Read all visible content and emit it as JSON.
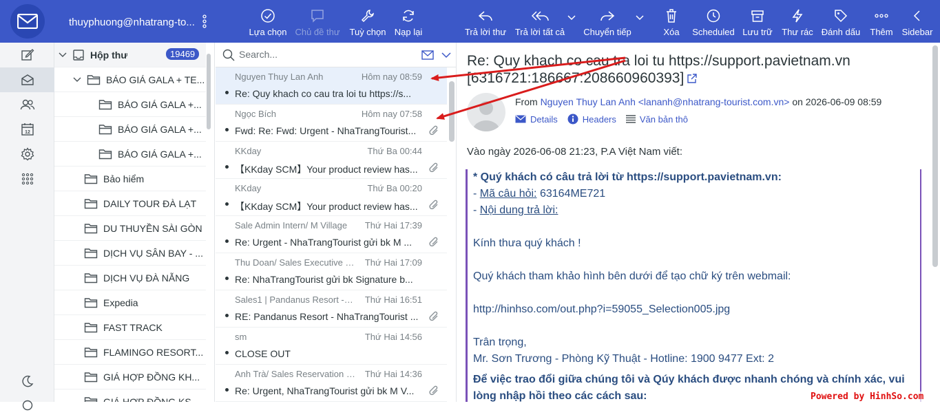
{
  "account": "thuyphuong@nhatrang-to...",
  "toolbar": {
    "select": "Lựa chọn",
    "thread": "Chủ đề thư",
    "options": "Tuỳ chọn",
    "refresh": "Nạp lại",
    "reply": "Trả lời thư",
    "reply_all": "Trả lời tất cả",
    "forward": "Chuyển tiếp",
    "delete": "Xóa",
    "scheduled": "Scheduled",
    "archive": "Lưu trữ",
    "junk": "Thư rác",
    "mark": "Đánh dấu",
    "more": "Thêm",
    "sidebar": "Sidebar"
  },
  "folders": {
    "inbox": {
      "label": "Hộp thư",
      "count": "19469"
    },
    "items": [
      {
        "label": "BÁO GIÁ GALA + TE...",
        "icon": "folder-icon"
      },
      {
        "label": "BÁO GIÁ GALA +...",
        "icon": "folder-icon"
      },
      {
        "label": "BÁO GIÁ GALA +...",
        "icon": "folder-icon"
      },
      {
        "label": "BÁO GIÁ GALA +...",
        "icon": "folder-icon"
      },
      {
        "label": "Bảo hiểm",
        "icon": "folder-icon"
      },
      {
        "label": "DAILY TOUR ĐÀ LẠT",
        "icon": "folder-icon"
      },
      {
        "label": "DU THUYỀN SÀI GÒN",
        "icon": "folder-icon"
      },
      {
        "label": "DỊCH VỤ SÂN BAY - ...",
        "icon": "folder-icon"
      },
      {
        "label": "DỊCH VỤ ĐÀ NẴNG",
        "icon": "folder-icon"
      },
      {
        "label": "Expedia",
        "icon": "folder-icon"
      },
      {
        "label": "FAST TRACK",
        "icon": "folder-icon"
      },
      {
        "label": "FLAMINGO RESORT...",
        "icon": "folder-icon"
      },
      {
        "label": "GIÁ HỢP ĐỒNG KH...",
        "icon": "folder-icon"
      },
      {
        "label": "GIÁ HỢP ĐỒNG KS...",
        "icon": "folder-icon"
      }
    ]
  },
  "search": {
    "placeholder": "Search..."
  },
  "messages": [
    {
      "from": "Nguyen Thuy Lan Anh",
      "date": "Hôm nay 08:59",
      "subject": "Re: Quy khach co cau tra loi tu https://s...",
      "attachment": false
    },
    {
      "from": "Ngọc Bích",
      "date": "Hôm nay 07:58",
      "subject": "Fwd: Re: Fwd: Urgent - NhaTrangTourist...",
      "attachment": true
    },
    {
      "from": "KKday",
      "date": "Thứ Ba 00:44",
      "subject": "【KKday SCM】Your product review has...",
      "attachment": true
    },
    {
      "from": "KKday",
      "date": "Thứ Ba 00:20",
      "subject": "【KKday SCM】Your product review has...",
      "attachment": true
    },
    {
      "from": "Sale Admin Intern/ M Village",
      "date": "Thứ Hai 17:39",
      "subject": "Re: Urgent - NhaTrangTourist gửi bk M ...",
      "attachment": true
    },
    {
      "from": "Thu Doan/ Sales Executive (B...",
      "date": "Thứ Hai 17:09",
      "subject": "Re: NhaTrangTourist gửi bk Signature b...",
      "attachment": false
    },
    {
      "from": "Sales1 | Pandanus Resort - M...",
      "date": "Thứ Hai 16:51",
      "subject": "RE: Pandanus Resort - NhaTrangTourist ...",
      "attachment": true
    },
    {
      "from": "sm",
      "date": "Thứ Hai 14:56",
      "subject": "CLOSE OUT",
      "attachment": false
    },
    {
      "from": "Anh Trà/ Sales Reservation Ex...",
      "date": "Thứ Hai 14:36",
      "subject": "Re: Urgent, NhaTrangTourist gửi bk M V...",
      "attachment": true
    }
  ],
  "reader": {
    "subject": "Re: Quy khach co cau tra loi tu https://support.pavietnam.vn [6316721:186667:208660960393]",
    "from_label": "From",
    "from_name": "Nguyen Thuy Lan Anh",
    "from_email": "<lananh@nhatrang-tourist.com.vn>",
    "date_text": "on 2026-06-09 08:59",
    "details": "Details",
    "headers": "Headers",
    "plain": "Văn bản thô",
    "intro": "Vào ngày 2026-06-08 21:23, P.A Việt Nam viết:",
    "quote": {
      "line1": "* Quý khách có câu trả lời từ https://support.pavietnam.vn:",
      "q_label": "Mã câu hỏi:",
      "q_value": " 63164ME721",
      "content_label": "Nội dung trả lời:",
      "greeting": "Kính thưa quý khách !",
      "body": "Quý khách tham khảo hình bên dưới để tạo chữ ký trên webmail:",
      "link": "http://hinhso.com/out.php?i=59055_Selection005.jpg",
      "regards": "Trân trọng,",
      "signature": "Mr. Sơn Trương - Phòng Kỹ Thuật - Hotline: 1900 9477 Ext: 2",
      "closing1": "Để việc trao đổi giữa chúng tôi và Qúy khách được nhanh chóng và chính xác, vui",
      "closing2": "lòng nhập hồi theo các cách sau:"
    }
  },
  "watermark": "Powered by HinhSo.com",
  "colors": {
    "brand": "#3c58c8",
    "arrow": "#d91c1c",
    "quote_border": "#7a52b8"
  }
}
